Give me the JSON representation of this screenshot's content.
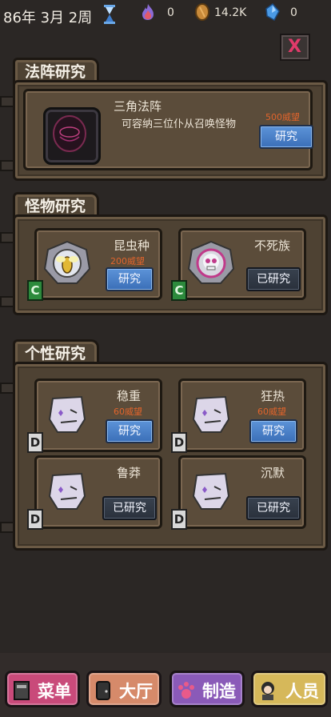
{
  "topbar": {
    "date": "86年 3月 2周",
    "res_soul": "0",
    "res_gold": "14.2K",
    "res_gem": "0"
  },
  "close": {
    "label": "X"
  },
  "formation": {
    "tab": "法阵研究",
    "name": "三角法阵",
    "desc": "可容纳三位仆从召唤怪物",
    "cost": "500威望",
    "button": "研究"
  },
  "monster": {
    "tab": "怪物研究",
    "items": [
      {
        "name": "昆虫种",
        "cost": "200威望",
        "button": "研究",
        "tag": "C"
      },
      {
        "name": "不死族",
        "cost": "",
        "button": "已研究",
        "tag": "C"
      }
    ]
  },
  "trait": {
    "tab": "个性研究",
    "items": [
      {
        "name": "稳重",
        "cost": "60威望",
        "button": "研究",
        "tag": "D"
      },
      {
        "name": "狂热",
        "cost": "60威望",
        "button": "研究",
        "tag": "D"
      },
      {
        "name": "鲁莽",
        "cost": "",
        "button": "已研究",
        "tag": "D"
      },
      {
        "name": "沉默",
        "cost": "",
        "button": "已研究",
        "tag": "D"
      }
    ]
  },
  "nav": {
    "menu": "菜单",
    "hall": "大厅",
    "craft": "制造",
    "staff": "人员"
  },
  "colors": {
    "menu": "#c94a7a",
    "hall": "#d68a6a",
    "craft": "#8a5ab8",
    "staff": "#d6b85a"
  }
}
